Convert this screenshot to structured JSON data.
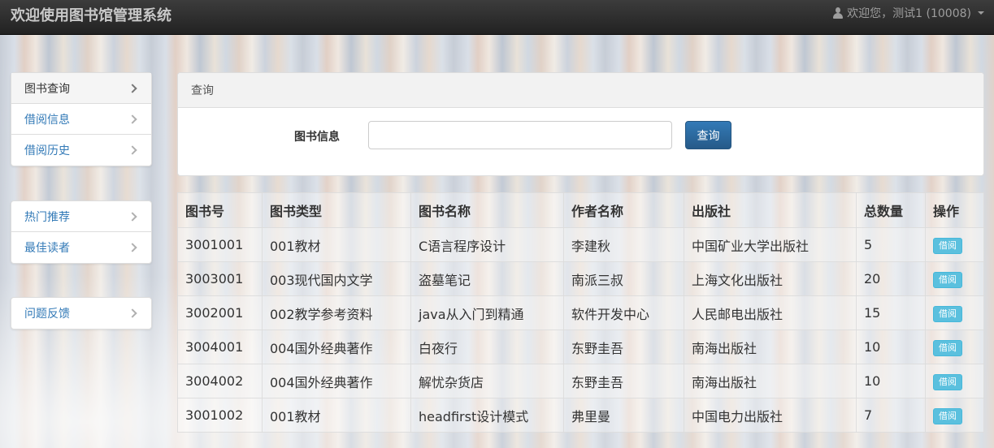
{
  "navbar": {
    "brand": "欢迎使用图书馆管理系统",
    "user_greeting": "欢迎您，测试1 (10008)"
  },
  "menus": [
    {
      "items": [
        {
          "label": "图书查询",
          "active": true
        },
        {
          "label": "借阅信息",
          "active": false
        },
        {
          "label": "借阅历史",
          "active": false
        }
      ]
    },
    {
      "items": [
        {
          "label": "热门推荐",
          "active": false
        },
        {
          "label": "最佳读者",
          "active": false
        }
      ]
    },
    {
      "items": [
        {
          "label": "问题反馈",
          "active": false
        }
      ]
    }
  ],
  "search_panel": {
    "heading": "查询",
    "field_label": "图书信息",
    "input_value": "",
    "button_label": "查询"
  },
  "table": {
    "headers": [
      "图书号",
      "图书类型",
      "图书名称",
      "作者名称",
      "出版社",
      "总数量",
      "操作"
    ],
    "rows": [
      [
        "3001001",
        "001教材",
        "C语言程序设计",
        "李建秋",
        "中国矿业大学出版社",
        "5",
        "借阅"
      ],
      [
        "3003001",
        "003现代国内文学",
        "盗墓笔记",
        "南派三叔",
        "上海文化出版社",
        "20",
        "借阅"
      ],
      [
        "3002001",
        "002教学参考资料",
        "java从入门到精通",
        "软件开发中心",
        "人民邮电出版社",
        "15",
        "借阅"
      ],
      [
        "3004001",
        "004国外经典著作",
        "白夜行",
        "东野圭吾",
        "南海出版社",
        "10",
        "借阅"
      ],
      [
        "3004002",
        "004国外经典著作",
        "解忧杂货店",
        "东野圭吾",
        "南海出版社",
        "10",
        "借阅"
      ],
      [
        "3001002",
        "001教材",
        "headfirst设计模式",
        "弗里曼",
        "中国电力出版社",
        "7",
        "借阅"
      ]
    ]
  },
  "colors": {
    "primary": "#337ab7",
    "info": "#5bc0de",
    "navbar": "#222222"
  }
}
